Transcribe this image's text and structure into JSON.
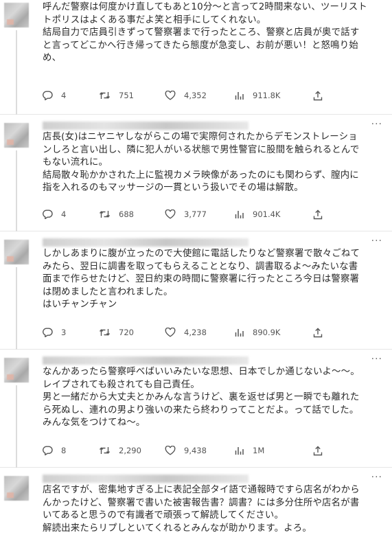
{
  "tweets": [
    {
      "text": "呼んだ警察は何度かけ直してもあと10分〜と言って2時間来ない、ツーリスト\nトポリスはよくある事だよ笑と相手にしてくれない。\n結局自力で店員引きずって警察署まで行ったところ、警察と店員が奥で話す\nと言ってどこかへ行き帰ってきたら態度が急変し、お前が悪い！と怒鳴り始\nめ、",
      "replies": "4",
      "retweets": "751",
      "likes": "4,352",
      "views": "911.8K"
    },
    {
      "text": "店長(女)はニヤニヤしながらこの場で実際何されたからデモンストレーショ\nンしろと言い出し、隣に犯人がいる状態で男性警官に股間を触られるとんで\nもない流れに。\n結局散々恥かかされた上に監視カメラ映像があったのにも関わらず、膣内に\n指を入れるのもマッサージの一貫という扱いでその場は解散。",
      "replies": "4",
      "retweets": "688",
      "likes": "3,777",
      "views": "901.4K"
    },
    {
      "text": "しかしあまりに腹が立ったので大使館に電話したりなど警察署で散々ごねて\nみたら、翌日に調書を取ってもらえることとなり、調書取るよ〜みたいな書\n面まで作らせたけど、翌日約束の時間に警察署に行ったところ今日は警察署\nは閉めましたと言われました。\nはいチャンチャン",
      "replies": "3",
      "retweets": "720",
      "likes": "4,238",
      "views": "890.9K"
    },
    {
      "text": "なんかあったら警察呼べばいいみたいな思想、日本でしか通じないよ〜〜。\nレイプされても殺されても自己責任。\n男と一緒だから大丈夫とかみんな言うけど、裏を返せば男と一瞬でも離れた\nら死ぬし、連れの男より強いの来たら終わりってことだよ。って話でした。\nみんな気をつけてね〜。",
      "replies": "8",
      "retweets": "2,290",
      "likes": "9,438",
      "views": "1M"
    },
    {
      "text": "店名ですが、密集地すぎる上に表記全部タイ語で通報時ですら店名がわから\nんかったけど、警察署で書いた被害報告書？調書？には多分住所や店名が書\nいてあると思うので有識者で頑張って解読してください。\n解読出来たらリプしといてくれるとみんなが助かります。よろ。"
    }
  ],
  "more_label": "···",
  "icons": {
    "reply": "reply-icon",
    "retweet": "retweet-icon",
    "like": "like-icon",
    "views": "views-icon",
    "share": "share-icon"
  },
  "colors": {
    "text": "#2a2a2a",
    "meta": "#555555",
    "divider": "#e6e6e6"
  }
}
